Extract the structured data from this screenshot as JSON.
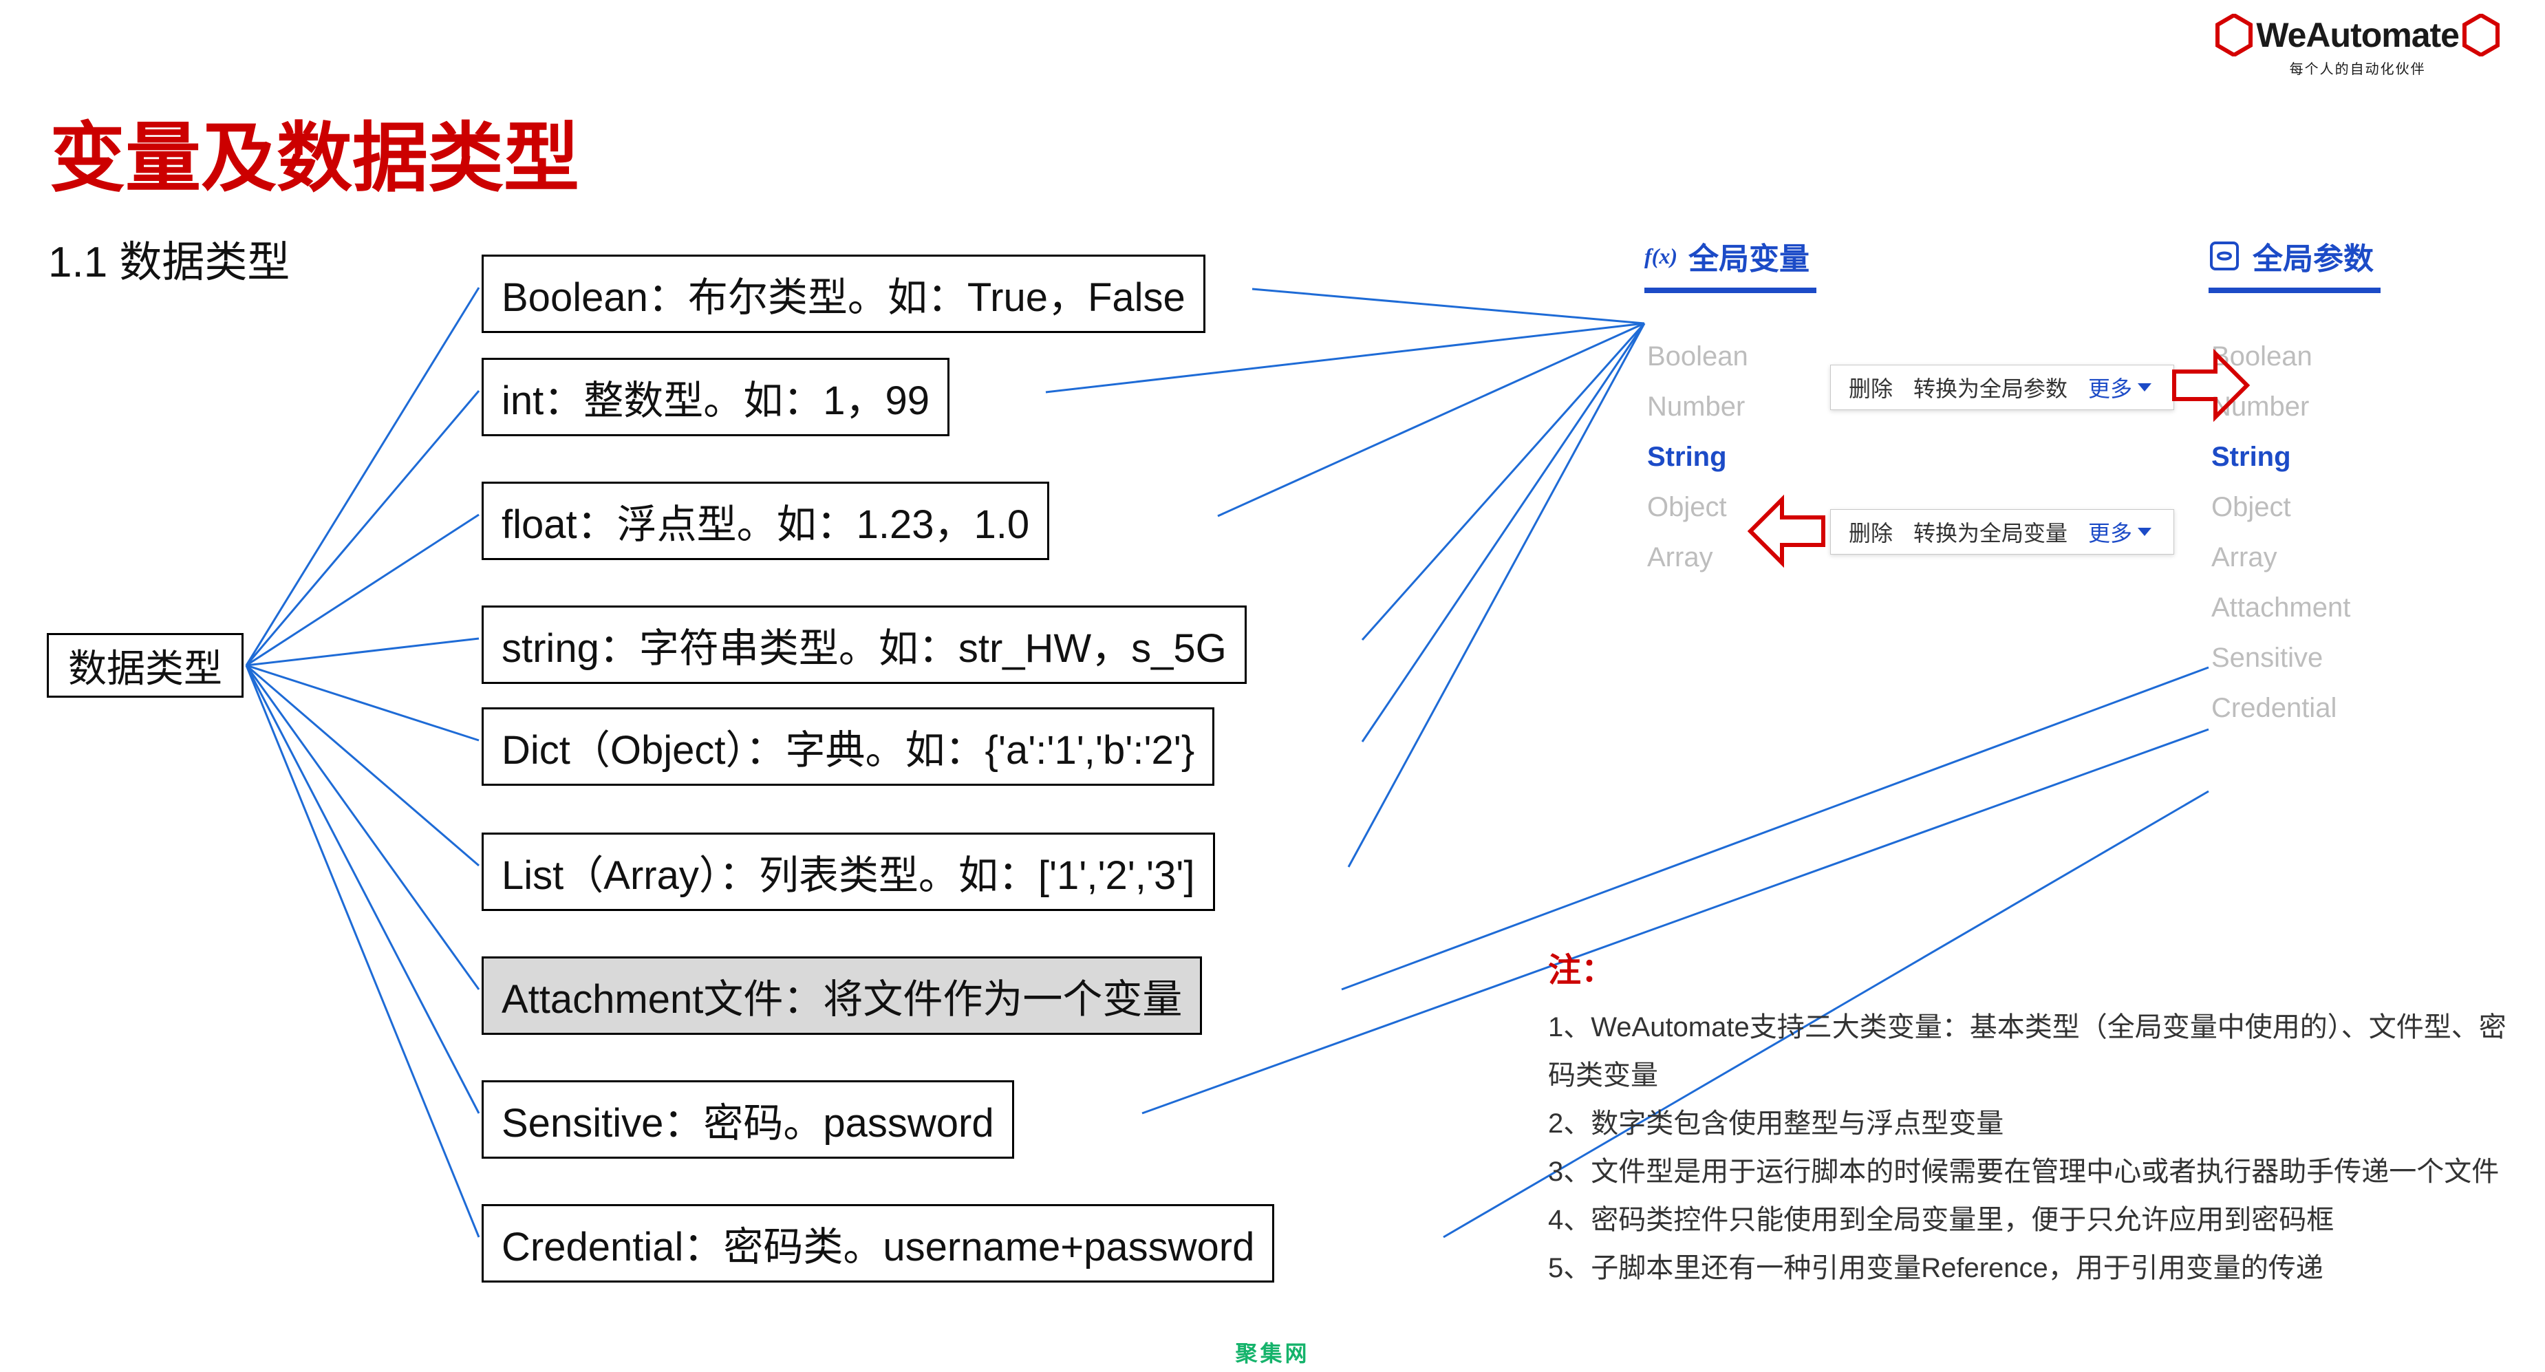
{
  "logo": {
    "text": "WeAutomate",
    "subtitle": "每个人的自动化伙伴"
  },
  "title": "变量及数据类型",
  "section": "1.1  数据类型",
  "root_label": "数据类型",
  "types": [
    {
      "text": "Boolean：布尔类型。如：True，False",
      "highlight": false
    },
    {
      "text": "int：整数型。如：1，99",
      "highlight": false
    },
    {
      "text": "float：浮点型。如：1.23，1.0",
      "highlight": false
    },
    {
      "text": "string：字符串类型。如：str_HW，s_5G",
      "highlight": false
    },
    {
      "text": "Dict（Object）：字典。如：{'a':'1','b':'2'}",
      "highlight": false
    },
    {
      "text": "List（Array）：列表类型。如：['1','2','3']",
      "highlight": false
    },
    {
      "text": "Attachment文件：将文件作为一个变量",
      "highlight": true
    },
    {
      "text": "Sensitive：密码。password",
      "highlight": false
    },
    {
      "text": "Credential：密码类。username+password",
      "highlight": false
    }
  ],
  "panels": {
    "global_vars": {
      "icon": "fx-icon",
      "title": "全局变量",
      "items": [
        "Boolean",
        "Number",
        "String",
        "Object",
        "Array"
      ],
      "selected": "String",
      "actions": {
        "delete": "删除",
        "convert": "转换为全局参数",
        "more": "更多"
      }
    },
    "global_params": {
      "icon": "param-icon",
      "title": "全局参数",
      "items": [
        "Boolean",
        "Number",
        "String",
        "Object",
        "Array",
        "Attachment",
        "Sensitive",
        "Credential"
      ],
      "selected": "String",
      "actions": {
        "delete": "删除",
        "convert": "转换为全局变量",
        "more": "更多"
      }
    }
  },
  "notes": {
    "heading": "注：",
    "lines": [
      "1、WeAutomate支持三大类变量：基本类型（全局变量中使用的）、文件型、密码类变量",
      "2、数字类包含使用整型与浮点型变量",
      "3、文件型是用于运行脚本的时候需要在管理中心或者执行器助手传递一个文件",
      "4、密码类控件只能使用到全局变量里，便于只允许应用到密码框",
      "5、子脚本里还有一种引用变量Reference，用于引用变量的传递"
    ]
  },
  "watermark": "聚集网"
}
